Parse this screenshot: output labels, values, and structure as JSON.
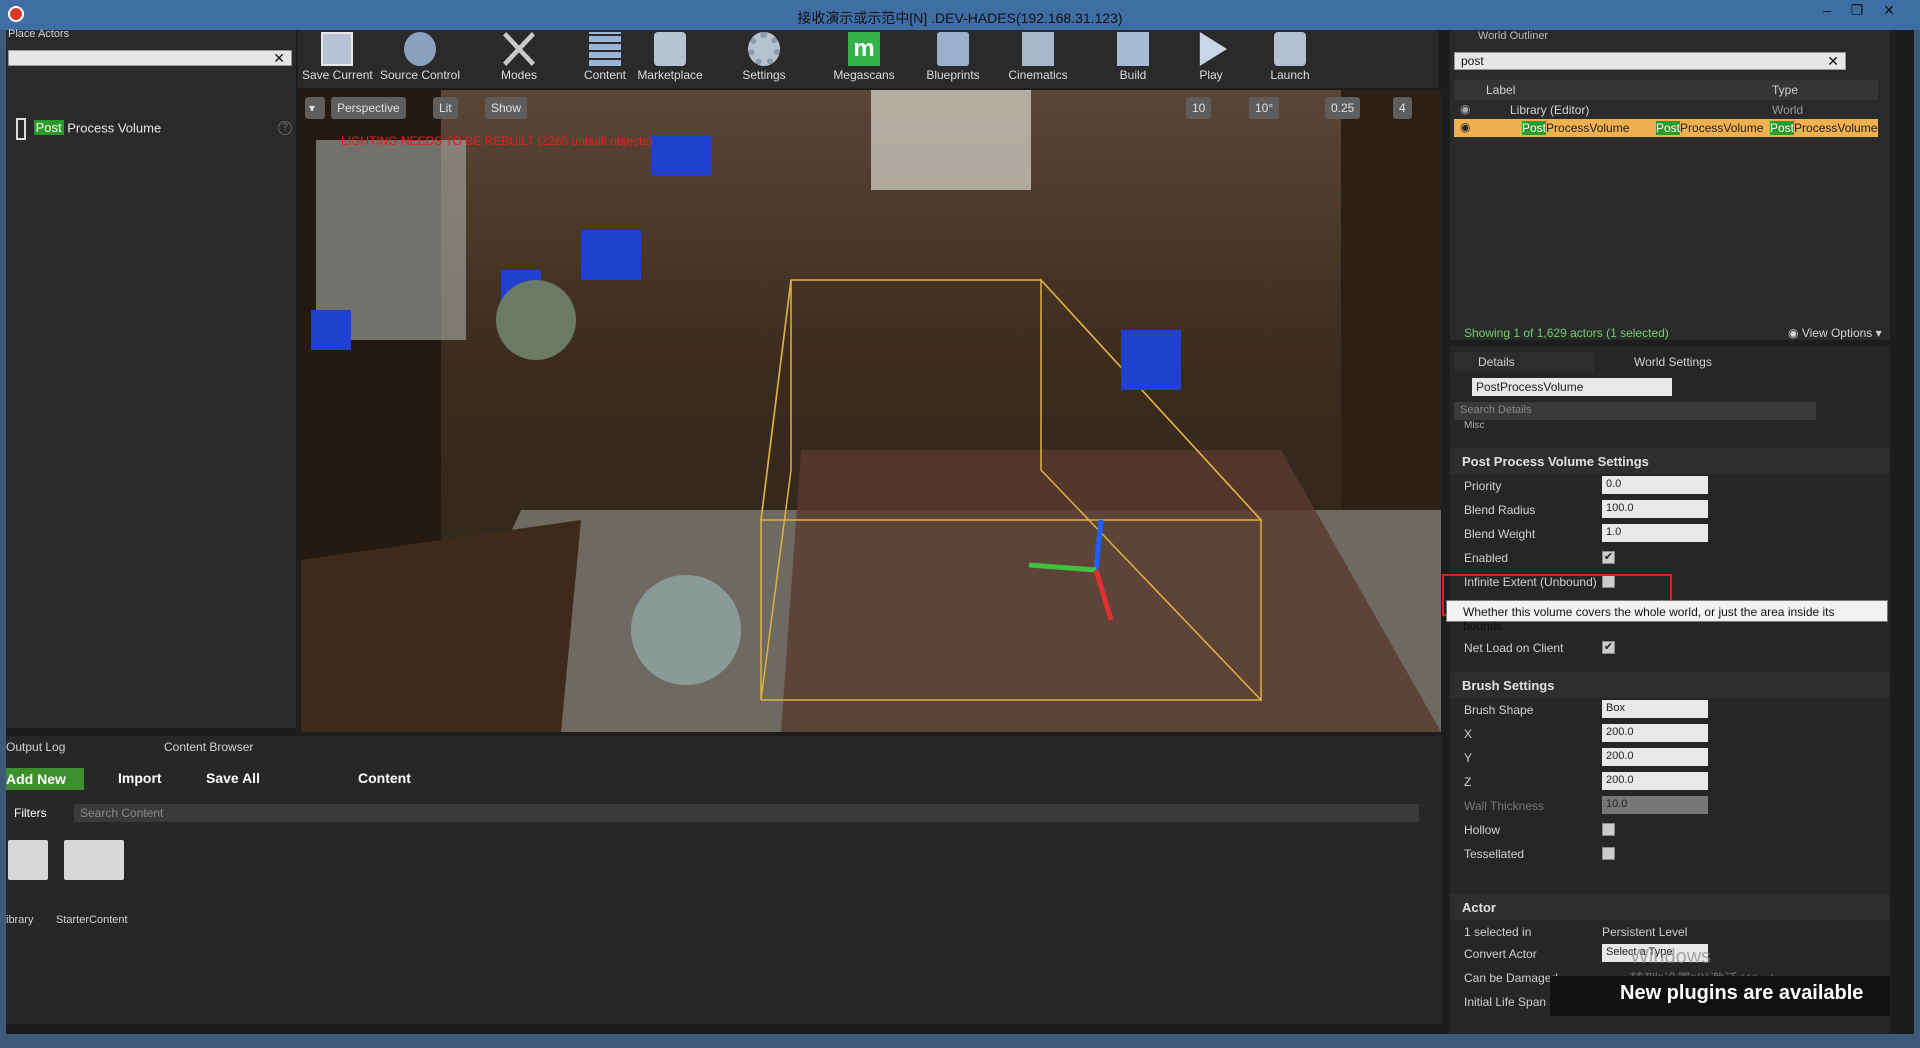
{
  "window": {
    "title": "接收演示或示范中[N] .DEV-HADES(192.168.31.123)",
    "min": "–",
    "max": "❐",
    "close": "✕"
  },
  "place_actors": {
    "tab": "Place Actors",
    "search_value": "",
    "result_hl": "Post",
    "result_rest": " Process Volume"
  },
  "toolbar": {
    "items": [
      "Save Current",
      "Source Control",
      "Modes",
      "Content",
      "Marketplace",
      "Settings",
      "Megascans",
      "Blueprints",
      "Cinematics",
      "Build",
      "Play",
      "Launch"
    ]
  },
  "viewport": {
    "perspective": "Perspective",
    "lit": "Lit",
    "show": "Show",
    "warning": "LIGHTING NEEDS TO BE REBUILT (2265 unbuilt objects)",
    "grid": "10",
    "rot": "10°",
    "scale": "0.25",
    "cam": "4"
  },
  "outliner": {
    "tab": "World Outliner",
    "search_value": "post",
    "col_label": "Label",
    "col_type": "Type",
    "row1_label": "Library (Editor)",
    "row1_type": "World",
    "row2_hl": "Post",
    "row2_rest": "ProcessVolume",
    "row2_type_hl": "Post",
    "row2_type_rest": "ProcessVolume",
    "row2_type2_hl": "Post",
    "row2_type2_rest": "ProcessVolume",
    "status": "Showing 1 of 1,629 actors (1 selected)",
    "view_options": "View Options"
  },
  "details": {
    "tab_details": "Details",
    "tab_world": "World Settings",
    "name_value": "PostProcessVolume",
    "search_placeholder": "Search Details",
    "misc": "Misc",
    "cat_ppv": "Post Process Volume Settings",
    "priority_k": "Priority",
    "priority_v": "0.0",
    "radius_k": "Blend Radius",
    "radius_v": "100.0",
    "weight_k": "Blend Weight",
    "weight_v": "1.0",
    "enabled_k": "Enabled",
    "infinite_k": "Infinite Extent (Unbound)",
    "tooltip": "Whether this volume covers the whole world, or just the area inside its bounds.",
    "netload_k": "Net Load on Client",
    "cat_brush": "Brush Settings",
    "shape_k": "Brush Shape",
    "shape_v": "Box",
    "x_k": "X",
    "x_v": "200.0",
    "y_k": "Y",
    "y_v": "200.0",
    "z_k": "Z",
    "z_v": "200.0",
    "wall_k": "Wall Thickness",
    "wall_v": "10.0",
    "hollow_k": "Hollow",
    "tess_k": "Tessellated",
    "cat_actor": "Actor",
    "sel_k": "1 selected in",
    "sel_v": "Persistent Level",
    "convert_k": "Convert Actor",
    "convert_v": "Select a Type",
    "damaged_k": "Can be Damaged",
    "life_k": "Initial Life Span"
  },
  "bottom": {
    "tab_output": "Output Log",
    "tab_content": "Content Browser",
    "add_new": "Add New",
    "import": "Import",
    "save_all": "Save All",
    "path": "Content",
    "filters": "Filters",
    "search_placeholder": "Search Content",
    "folders": [
      "ibrary",
      "StarterContent"
    ]
  },
  "watermark": {
    "line1": "Windows",
    "line2": "转到\"设置\"以激活 Windows。"
  },
  "notice": "New plugins are available"
}
